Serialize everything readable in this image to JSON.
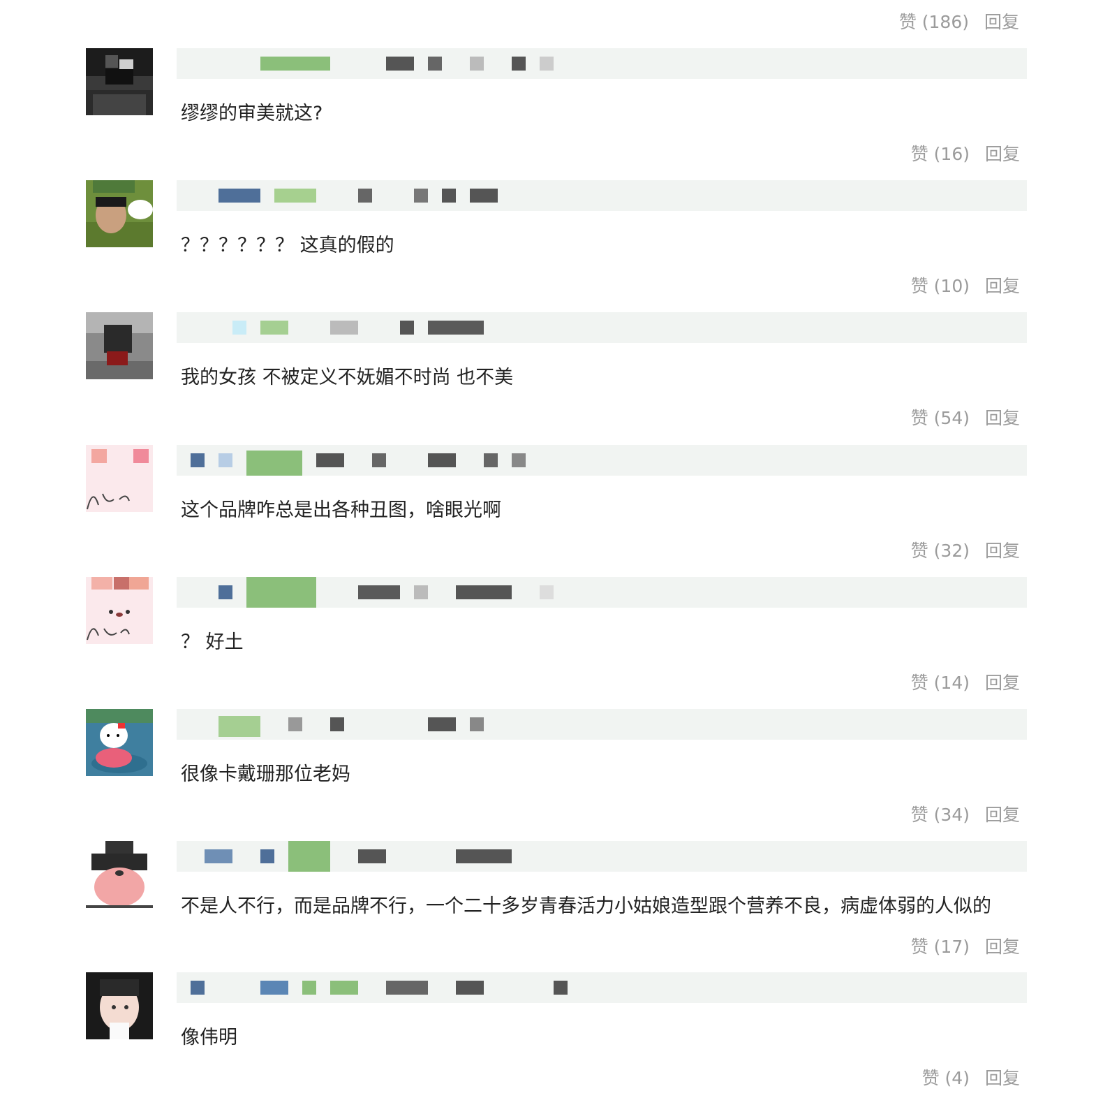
{
  "top": {
    "like_label": "赞 (186)",
    "reply_label": "回复"
  },
  "comments": [
    {
      "text": "缪缪的审美就这?",
      "like_label": "赞 (16)",
      "reply_label": "回复"
    },
    {
      "text": "？？？？？？ 这真的假的",
      "like_label": "赞 (10)",
      "reply_label": "回复"
    },
    {
      "text": "我的女孩 不被定义不妩媚不时尚 也不美",
      "like_label": "赞 (54)",
      "reply_label": "回复"
    },
    {
      "text": "这个品牌咋总是出各种丑图，啥眼光啊",
      "like_label": "赞 (32)",
      "reply_label": "回复"
    },
    {
      "text": "？ 好土",
      "like_label": "赞 (14)",
      "reply_label": "回复"
    },
    {
      "text": "很像卡戴珊那位老妈",
      "like_label": "赞 (34)",
      "reply_label": "回复"
    },
    {
      "text": "不是人不行，而是品牌不行，一个二十多岁青春活力小姑娘造型跟个营养不良，病虚体弱的人似的",
      "like_label": "赞 (17)",
      "reply_label": "回复"
    },
    {
      "text": "像伟明",
      "like_label": "赞 (4)",
      "reply_label": "回复"
    }
  ]
}
